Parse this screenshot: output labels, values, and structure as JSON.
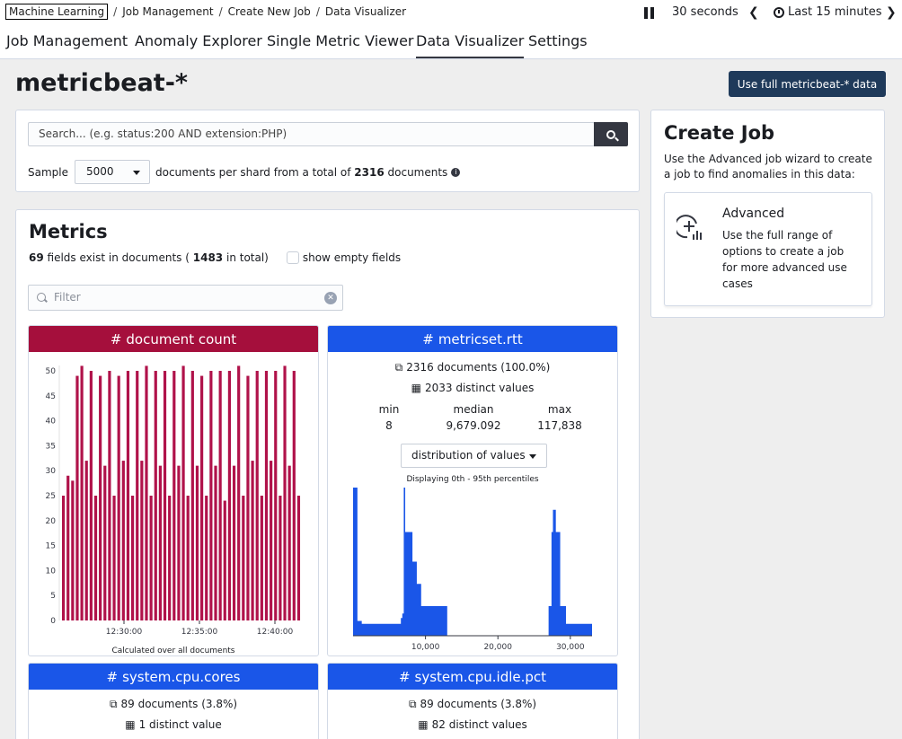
{
  "breadcrumbs": [
    "Machine Learning",
    "Job Management",
    "Create New Job",
    "Data Visualizer"
  ],
  "refresh": {
    "interval": "30 seconds",
    "time_range": "Last 15 minutes"
  },
  "tabs": [
    "Job Management",
    "Anomaly Explorer",
    "Single Metric Viewer",
    "Data Visualizer",
    "Settings"
  ],
  "active_tab": "Data Visualizer",
  "page_title": "metricbeat-*",
  "full_data_button": "Use full metricbeat-* data",
  "search": {
    "placeholder": "Search... (e.g. status:200 AND extension:PHP)"
  },
  "sample": {
    "label": "Sample",
    "value": "5000",
    "suffix_a": "documents per shard from a total of",
    "total": "2316",
    "suffix_b": "documents"
  },
  "metrics": {
    "title": "Metrics",
    "fields_count": "69",
    "fields_text_a": "fields exist in documents (",
    "fields_total": "1483",
    "fields_text_b": "in total)",
    "show_empty": "show empty fields",
    "filter_placeholder": "Filter"
  },
  "cards": {
    "doc_count": {
      "title": "document count",
      "color": "#a50f3c",
      "caption": "Calculated over all documents"
    },
    "metricset_rtt": {
      "title": "metricset.rtt",
      "color": "#1a56e8",
      "documents": "2316 documents (100.0%)",
      "distinct": "2033 distinct values",
      "min_label": "min",
      "median_label": "median",
      "max_label": "max",
      "min": "8",
      "median": "9,679.092",
      "max": "117,838",
      "select": "distribution of values",
      "caption": "Displaying 0th - 95th percentiles"
    },
    "cpu_cores": {
      "title": "system.cpu.cores",
      "color": "#1a56e8",
      "documents": "89 documents (3.8%)",
      "distinct": "1 distinct value"
    },
    "cpu_idle": {
      "title": "system.cpu.idle.pct",
      "color": "#1a56e8",
      "documents": "89 documents (3.8%)",
      "distinct": "82 distinct values"
    }
  },
  "create_job": {
    "title": "Create Job",
    "description": "Use the Advanced job wizard to create a job to find anomalies in this data:",
    "advanced_title": "Advanced",
    "advanced_desc": "Use the full range of options to create a job for more advanced use cases"
  },
  "chart_data": [
    {
      "type": "bar",
      "title": "document count",
      "xlabel": "Calculated over all documents",
      "x_ticks": [
        "12:30:00",
        "12:35:00",
        "12:40:00"
      ],
      "ylim": [
        0,
        50
      ],
      "y_ticks": [
        0,
        5,
        10,
        15,
        20,
        25,
        30,
        35,
        40,
        45,
        50
      ],
      "values": [
        25,
        29,
        28,
        49,
        51,
        32,
        50,
        25,
        49,
        31,
        50,
        25,
        49,
        32,
        50,
        25,
        50,
        32,
        51,
        25,
        50,
        31,
        50,
        25,
        50,
        31,
        51,
        25,
        50,
        31,
        49,
        25,
        50,
        31,
        50,
        24,
        50,
        31,
        51,
        25,
        49,
        32,
        50,
        25,
        50,
        32,
        50,
        25,
        51,
        31,
        50,
        25
      ]
    },
    {
      "type": "area",
      "title": "metricset.rtt",
      "x_ticks": [
        "10,000",
        "20,000",
        "30,000"
      ],
      "xlim": [
        0,
        33000
      ],
      "x": [
        0,
        300,
        600,
        1200,
        2000,
        3000,
        4000,
        5000,
        6000,
        6400,
        6600,
        6800,
        7000,
        7200,
        7600,
        8200,
        8800,
        9400,
        10000,
        11000,
        12000,
        12600,
        13000,
        14000,
        16000,
        18000,
        20000,
        22000,
        24000,
        25000,
        26000,
        26600,
        27000,
        27200,
        27400,
        27600,
        28000,
        28600,
        29400,
        30000,
        31000,
        32500
      ],
      "values": [
        100,
        100,
        10,
        8,
        8,
        8,
        8,
        8,
        8,
        8,
        12,
        15,
        100,
        70,
        70,
        50,
        35,
        20,
        20,
        20,
        20,
        20,
        0,
        0,
        0,
        0,
        0,
        0,
        0,
        0,
        0,
        0,
        20,
        20,
        70,
        85,
        70,
        20,
        8,
        8,
        8,
        8
      ]
    }
  ]
}
